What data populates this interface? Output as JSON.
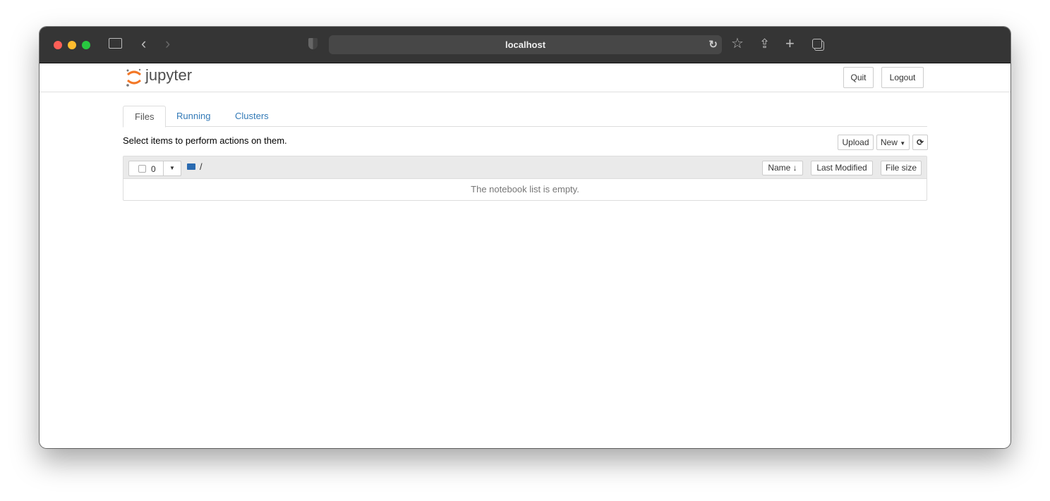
{
  "browser": {
    "url": "localhost",
    "icons": [
      "sidebar-icon",
      "back-icon",
      "forward-icon",
      "shield-icon",
      "reload-icon",
      "star-icon",
      "share-icon",
      "new-tab-icon",
      "tabs-icon"
    ]
  },
  "header": {
    "logo": "jupyter",
    "quit": "Quit",
    "logout": "Logout"
  },
  "tabs": [
    {
      "label": "Files",
      "active": true
    },
    {
      "label": "Running"
    },
    {
      "label": "Clusters"
    }
  ],
  "toolbar": {
    "hint": "Select items to perform actions on them.",
    "upload": "Upload",
    "new": "New"
  },
  "list": {
    "selected_count": "0",
    "path": "/",
    "columns": [
      "Name",
      "Last Modified",
      "File size"
    ],
    "empty": "The notebook list is empty."
  },
  "colors": {
    "accent": "#337ab7",
    "logo": "#f37726"
  }
}
